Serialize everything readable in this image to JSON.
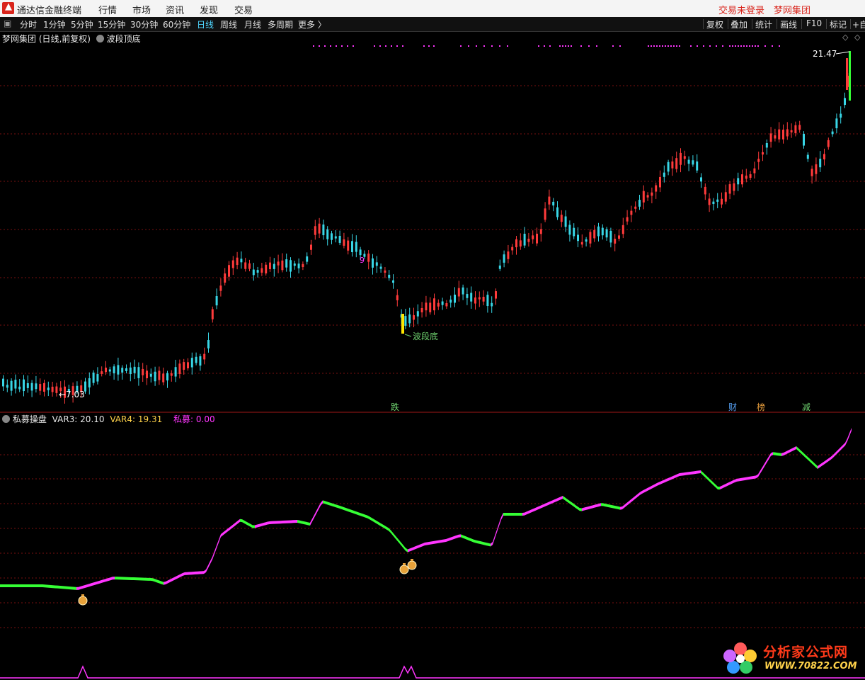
{
  "menubar": {
    "app_title": "通达信金融终端",
    "logo_glyph": "▲",
    "items": [
      "行情",
      "市场",
      "资讯",
      "发现",
      "交易"
    ],
    "login_status": "交易未登录",
    "brand": "梦网集团"
  },
  "toolbar": {
    "periods": [
      "分时",
      "1分钟",
      "5分钟",
      "15分钟",
      "30分钟",
      "60分钟",
      "日线",
      "周线",
      "月线",
      "多周期",
      "更多 〉"
    ],
    "active_period": "日线",
    "right_buttons": [
      "复权",
      "叠加",
      "统计",
      "画线",
      "F10",
      "标记",
      "+自"
    ]
  },
  "main_chart": {
    "stock_label": "梦网集团 (日线,前复权)",
    "indicator_label": "波段顶底",
    "high_label": "21.47",
    "low_label": "←7.03",
    "signal_label": "波段底",
    "counter_label": "9",
    "events": [
      "跌",
      "财",
      "榜",
      "减"
    ],
    "event_colors": [
      "#6fd36f",
      "#5aa8ff",
      "#e39a3a",
      "#6fd36f"
    ]
  },
  "sub_chart": {
    "name": "私募操盘",
    "var3_label": "VAR3:",
    "var3_value": "20.10",
    "var4_label": "VAR4:",
    "var4_value": "19.31",
    "pm_label": "私募:",
    "pm_value": "0.00"
  },
  "colors": {
    "up": "#ff3b3b",
    "down": "#38d6e6",
    "magenta": "#ff35ff",
    "green": "#35ff35",
    "grid": "#7a1010"
  },
  "watermark": {
    "title": "分析家公式网",
    "url": "WWW.70822.COM"
  },
  "chart_data": {
    "type": "candlestick",
    "period": "daily",
    "price_labels": {
      "high": 21.47,
      "low": 7.03
    },
    "sub_indicator": {
      "name": "私募操盘",
      "VAR3": 20.1,
      "VAR4": 19.31,
      "私募": 0.0
    }
  }
}
